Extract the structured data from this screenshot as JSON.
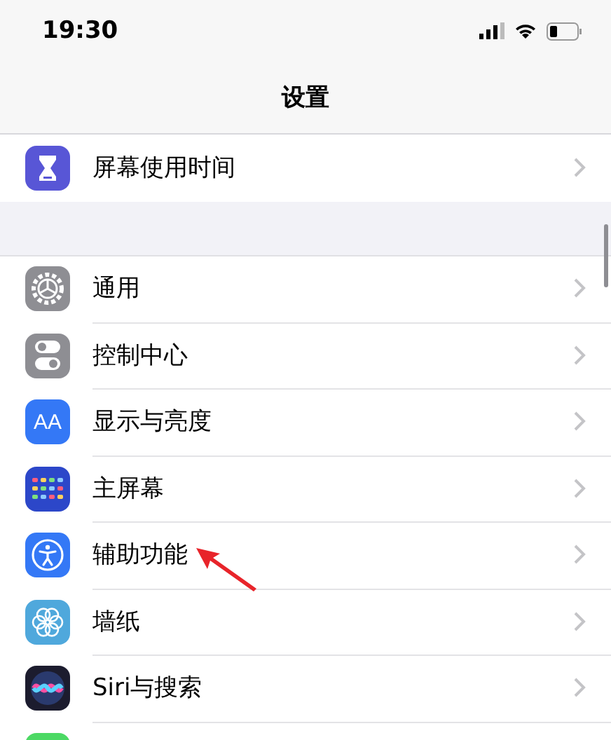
{
  "status_bar": {
    "time": "19:30"
  },
  "nav": {
    "title": "设置"
  },
  "groups": [
    {
      "items": [
        {
          "label": "屏幕使用时间",
          "kind": "hourglass",
          "color": "#5856d6",
          "pointer_arrow": false
        }
      ]
    },
    {
      "items": [
        {
          "label": "通用",
          "kind": "gear",
          "color": "#8e8e93",
          "pointer_arrow": false
        },
        {
          "label": "控制中心",
          "kind": "toggles",
          "color": "#8e8e93",
          "pointer_arrow": false
        },
        {
          "label": "显示与亮度",
          "kind": "textsize",
          "icon_label": "AA",
          "color": "#3478f6",
          "pointer_arrow": false
        },
        {
          "label": "主屏幕",
          "kind": "grid",
          "color": "#2c47c9",
          "pointer_arrow": false
        },
        {
          "label": "辅助功能",
          "kind": "accessibility",
          "color": "#3478f6",
          "pointer_arrow": true
        },
        {
          "label": "墙纸",
          "kind": "flower",
          "color": "#4fa8dc",
          "pointer_arrow": false
        },
        {
          "label": "Siri与搜索",
          "kind": "siri",
          "color": "#1c1c2e",
          "pointer_arrow": false
        },
        {
          "kind": "plain",
          "color": "#4cd964",
          "pointer_arrow": false
        }
      ]
    }
  ]
}
